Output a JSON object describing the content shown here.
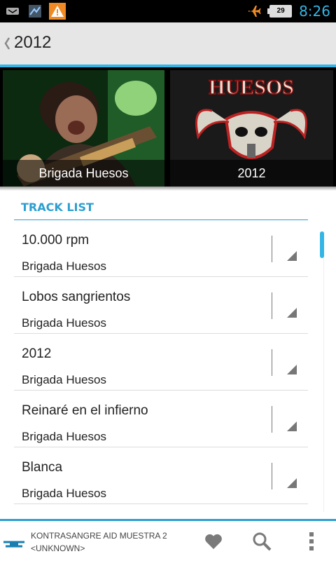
{
  "status_bar": {
    "time": "8:26",
    "battery_level": "29"
  },
  "action_bar": {
    "title": "2012"
  },
  "hero": {
    "tiles": [
      {
        "caption": "Brigada Huesos"
      },
      {
        "caption": "2012"
      }
    ],
    "album_art_text": "HUESOS"
  },
  "track_list": {
    "header": "TRACK LIST",
    "items": [
      {
        "title": "10.000 rpm",
        "artist": "Brigada Huesos"
      },
      {
        "title": "Lobos sangrientos",
        "artist": "Brigada Huesos"
      },
      {
        "title": "2012",
        "artist": "Brigada Huesos"
      },
      {
        "title": "Reinaré en el infierno",
        "artist": "Brigada Huesos"
      },
      {
        "title": "Blanca",
        "artist": "Brigada Huesos"
      }
    ]
  },
  "now_playing": {
    "title": "KONTRASANGRE AID MUESTRA 2",
    "artist": "<UNKNOWN>"
  },
  "colors": {
    "accent": "#33b5e5",
    "header_text": "#2e9fd0",
    "actionbar_bg": "#e6e6e6"
  }
}
